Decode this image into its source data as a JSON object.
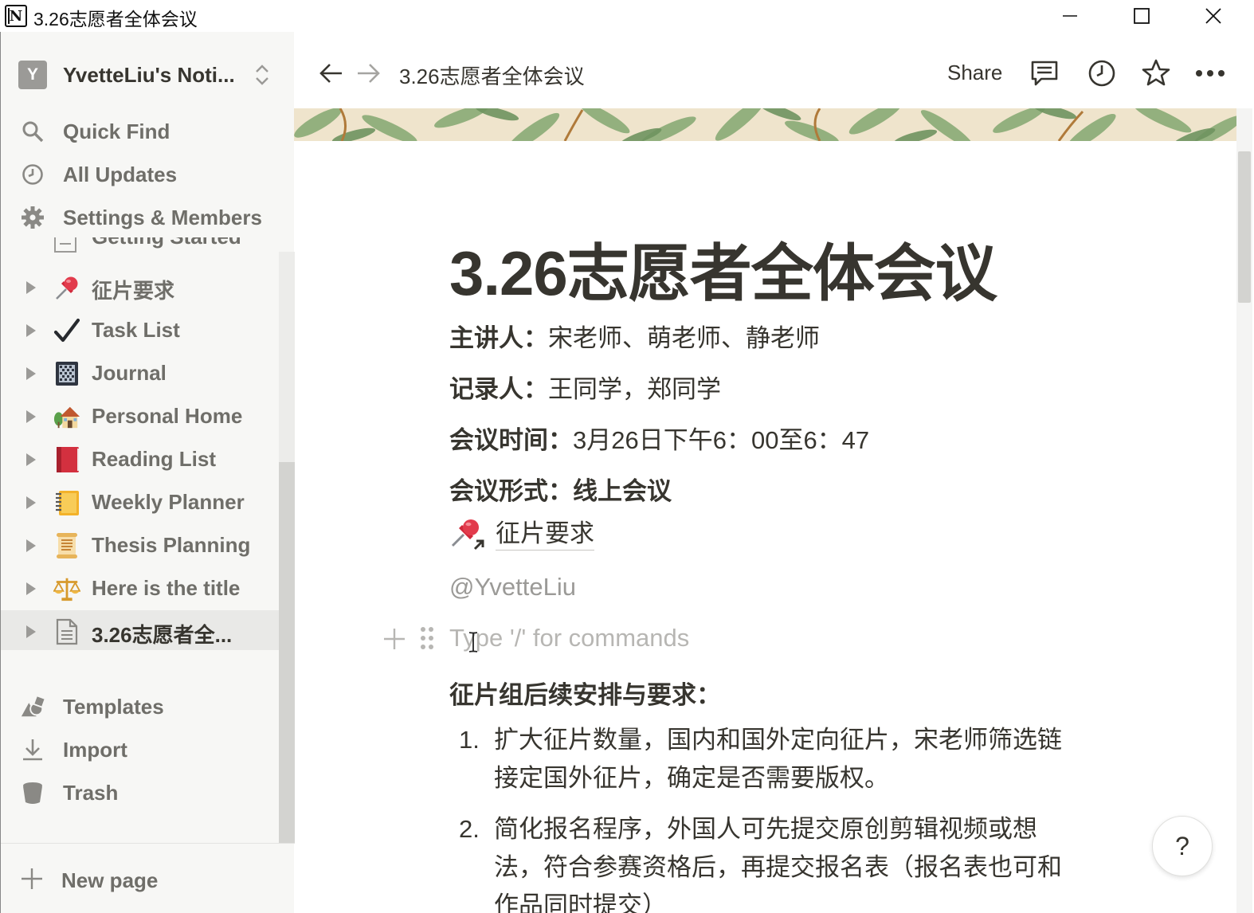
{
  "window": {
    "title": "3.26志愿者全体会议"
  },
  "sidebar": {
    "workspace_initial": "Y",
    "workspace_name": "YvetteLiu's Noti...",
    "nav": [
      {
        "label": "Quick Find",
        "icon": "search-icon"
      },
      {
        "label": "All Updates",
        "icon": "clock-icon"
      },
      {
        "label": "Settings & Members",
        "icon": "gear-icon"
      }
    ],
    "partial_item_label": "Getting Started",
    "pages": [
      {
        "label": "征片要求",
        "icon": "pushpin-icon"
      },
      {
        "label": "Task List",
        "icon": "checkmark-icon"
      },
      {
        "label": "Journal",
        "icon": "notebook-icon"
      },
      {
        "label": "Personal Home",
        "icon": "house-icon"
      },
      {
        "label": "Reading List",
        "icon": "red-book-icon"
      },
      {
        "label": "Weekly Planner",
        "icon": "spiral-notebook-icon"
      },
      {
        "label": "Thesis Planning",
        "icon": "scroll-icon"
      },
      {
        "label": "Here is the title",
        "icon": "scales-icon"
      },
      {
        "label": "3.26志愿者全...",
        "icon": "page-icon",
        "active": true
      }
    ],
    "bottom": [
      {
        "label": "Templates",
        "icon": "shapes-icon"
      },
      {
        "label": "Import",
        "icon": "download-icon"
      },
      {
        "label": "Trash",
        "icon": "trash-icon"
      }
    ],
    "new_page": "New page"
  },
  "topbar": {
    "breadcrumb": "3.26志愿者全体会议",
    "share": "Share"
  },
  "page": {
    "title": "3.26志愿者全体会议",
    "props": [
      {
        "key": "主讲人：",
        "value": "宋老师、萌老师、静老师"
      },
      {
        "key": "记录人：",
        "value": "王同学，郑同学"
      },
      {
        "key": "会议时间：",
        "value": "3月26日下午6：00至6：47"
      },
      {
        "key": "会议形式：线上会议",
        "value": ""
      }
    ],
    "linked_page": "征片要求",
    "mention": "@YvetteLiu",
    "placeholder": "Type '/' for commands",
    "section_heading": "征片组后续安排与要求：",
    "list": [
      {
        "num": "1.",
        "text": "扩大征片数量，国内和国外定向征片，宋老师筛选链接定国外征片，确定是否需要版权。"
      },
      {
        "num": "2.",
        "text": "简化报名程序，外国人可先提交原创剪辑视频或想法，符合参赛资格后，再提交报名表（报名表也可和作品同时提交）"
      }
    ]
  },
  "help_label": "?"
}
